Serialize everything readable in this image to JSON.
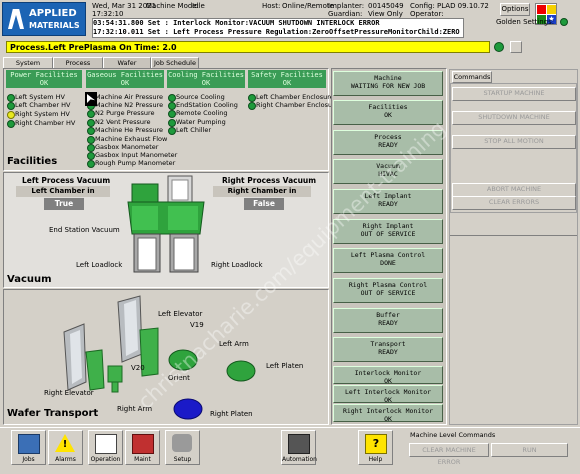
{
  "header": {
    "logo_line1": "APPLIED",
    "logo_line2": "MATERIALS",
    "date": "Wed, Mar 31 2021",
    "time": "17:32:10",
    "machine_mode_label": "Machine Mode:",
    "machine_mode_value": "Idle",
    "host_label": "Host:",
    "host_value": "Online/Remote",
    "implanter_label": "Implanter:",
    "implanter_value": "00145049",
    "guardian_label": "Guardian:",
    "guardian_value": "View Only",
    "config_label": "Config:",
    "config_value": "PLAD 09.10.72",
    "operator_label": "Operator:",
    "operator_value": "",
    "alarm1": "03:54:31.800 Set     : Interlock Monitor:VACUUM SHUTDOWN INTERLOCK ERROR",
    "alarm2": "17:32:10.011 Set     : Left Process Pressure Regulation:ZeroOffsetPressureMonitorChild:ZERO OFF",
    "options_label": "Options",
    "golden_label": "Golden Settings:",
    "process_bar": "Process.Left PrePlasma On Time: 2.0"
  },
  "tabs": [
    "System Startup",
    "Process Wafers",
    "Wafer Handler",
    "Job Schedule"
  ],
  "facilities": {
    "title": "Facilities",
    "groups": [
      {
        "name": "Power Facilities",
        "status": "OK",
        "items": [
          "Left System HV",
          "Left Chamber HV",
          "Right System HV",
          "Right Chamber HV"
        ]
      },
      {
        "name": "Gaseous Facilities",
        "status": "OK",
        "items": [
          "Machine Air Pressure",
          "Machine N2 Pressure",
          "N2 Purge Pressure",
          "N2 Vent Pressure",
          "Machine He Pressure",
          "Machine Exhaust Flow",
          "Gasbox Manometer",
          "Gasbox Input Manometer",
          "Rough Pump Manometer"
        ]
      },
      {
        "name": "Cooling Facilities",
        "status": "OK",
        "items": [
          "Source Cooling",
          "EndStation Cooling",
          "Remote Cooling",
          "Water Pumping",
          "Left Chiller"
        ]
      },
      {
        "name": "Safety Facilities",
        "status": "OK",
        "items": [
          "Left Chamber Enclosure",
          "Right Chamber Enclosure"
        ]
      }
    ]
  },
  "vacuum": {
    "title": "Vacuum",
    "left_head": "Left Process Vacuum",
    "left_service_label": "Left Chamber in Service",
    "left_service_value": "True",
    "right_head": "Right Process Vacuum",
    "right_service_label": "Right Chamber in Service",
    "right_service_value": "False",
    "end_station": "End Station Vacuum",
    "left_loadlock": "Left Loadlock",
    "right_loadlock": "Right Loadlock"
  },
  "wafer_transport": {
    "title": "Wafer Transport",
    "left_elevator": "Left Elevator",
    "right_elevator": "Right Elevator",
    "v19": "V19",
    "v20": "V20",
    "left_arm": "Left Arm",
    "right_arm": "Right Arm",
    "orient": "Orient",
    "left_platen": "Left Platen",
    "right_platen": "Right Platen"
  },
  "status_boxes": [
    {
      "name": "Machine",
      "value": "WAITING FOR NEW JOB"
    },
    {
      "name": "Facilities",
      "value": "OK"
    },
    {
      "name": "Process",
      "value": "READY"
    },
    {
      "name": "Vacuum",
      "value": "HIVAC"
    },
    {
      "name": "Left Implant",
      "value": "READY"
    },
    {
      "name": "Right Implant",
      "value": "OUT OF SERVICE"
    },
    {
      "name": "Left Plasma Control",
      "value": "DONE"
    },
    {
      "name": "Right Plasma Control",
      "value": "OUT OF SERVICE"
    },
    {
      "name": "Buffer",
      "value": "READY"
    },
    {
      "name": "Transport",
      "value": "READY"
    },
    {
      "name": "Interlock Monitor",
      "value": "OK"
    },
    {
      "name": "Left Interlock Monitor",
      "value": "OK"
    },
    {
      "name": "Right Interlock Monitor",
      "value": "OK"
    }
  ],
  "commands": {
    "tab": "Commands",
    "buttons": [
      "STARTUP MACHINE",
      "SHUTDOWN MACHINE",
      "STOP ALL MOTION",
      "ABORT MACHINE",
      "CLEAR ERRORS"
    ]
  },
  "machine_level": {
    "title": "Machine Level Commands",
    "clear": "CLEAR MACHINE ERROR",
    "run": "RUN"
  },
  "toolbar": [
    "Jobs",
    "Alarms",
    "Operation",
    "Maint",
    "Setup",
    "Automation",
    "Help"
  ],
  "watermark": "christnacharie.com/equipment-training"
}
